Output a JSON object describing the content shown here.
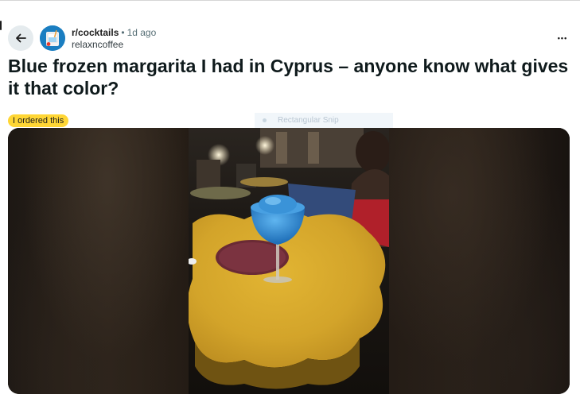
{
  "post": {
    "subreddit": "r/cocktails",
    "separator": "•",
    "age": "1d ago",
    "author": "relaxncoffee",
    "title": "Blue frozen margarita I had in Cyprus – anyone know what gives it that color?",
    "flair": "I ordered this",
    "more_label": "•••"
  },
  "overlay": {
    "tooltip_text": "Rectangular Snip"
  },
  "icons": {
    "back": "arrow-left-icon",
    "more": "overflow-menu-icon",
    "avatar": "subreddit-avatar"
  },
  "colors": {
    "flair_bg": "#ffd635",
    "back_button_bg": "#e5ebee",
    "avatar_bg": "#1a7ec1",
    "table_top": "#d9ad2c",
    "drink": "#2f8fd6"
  }
}
